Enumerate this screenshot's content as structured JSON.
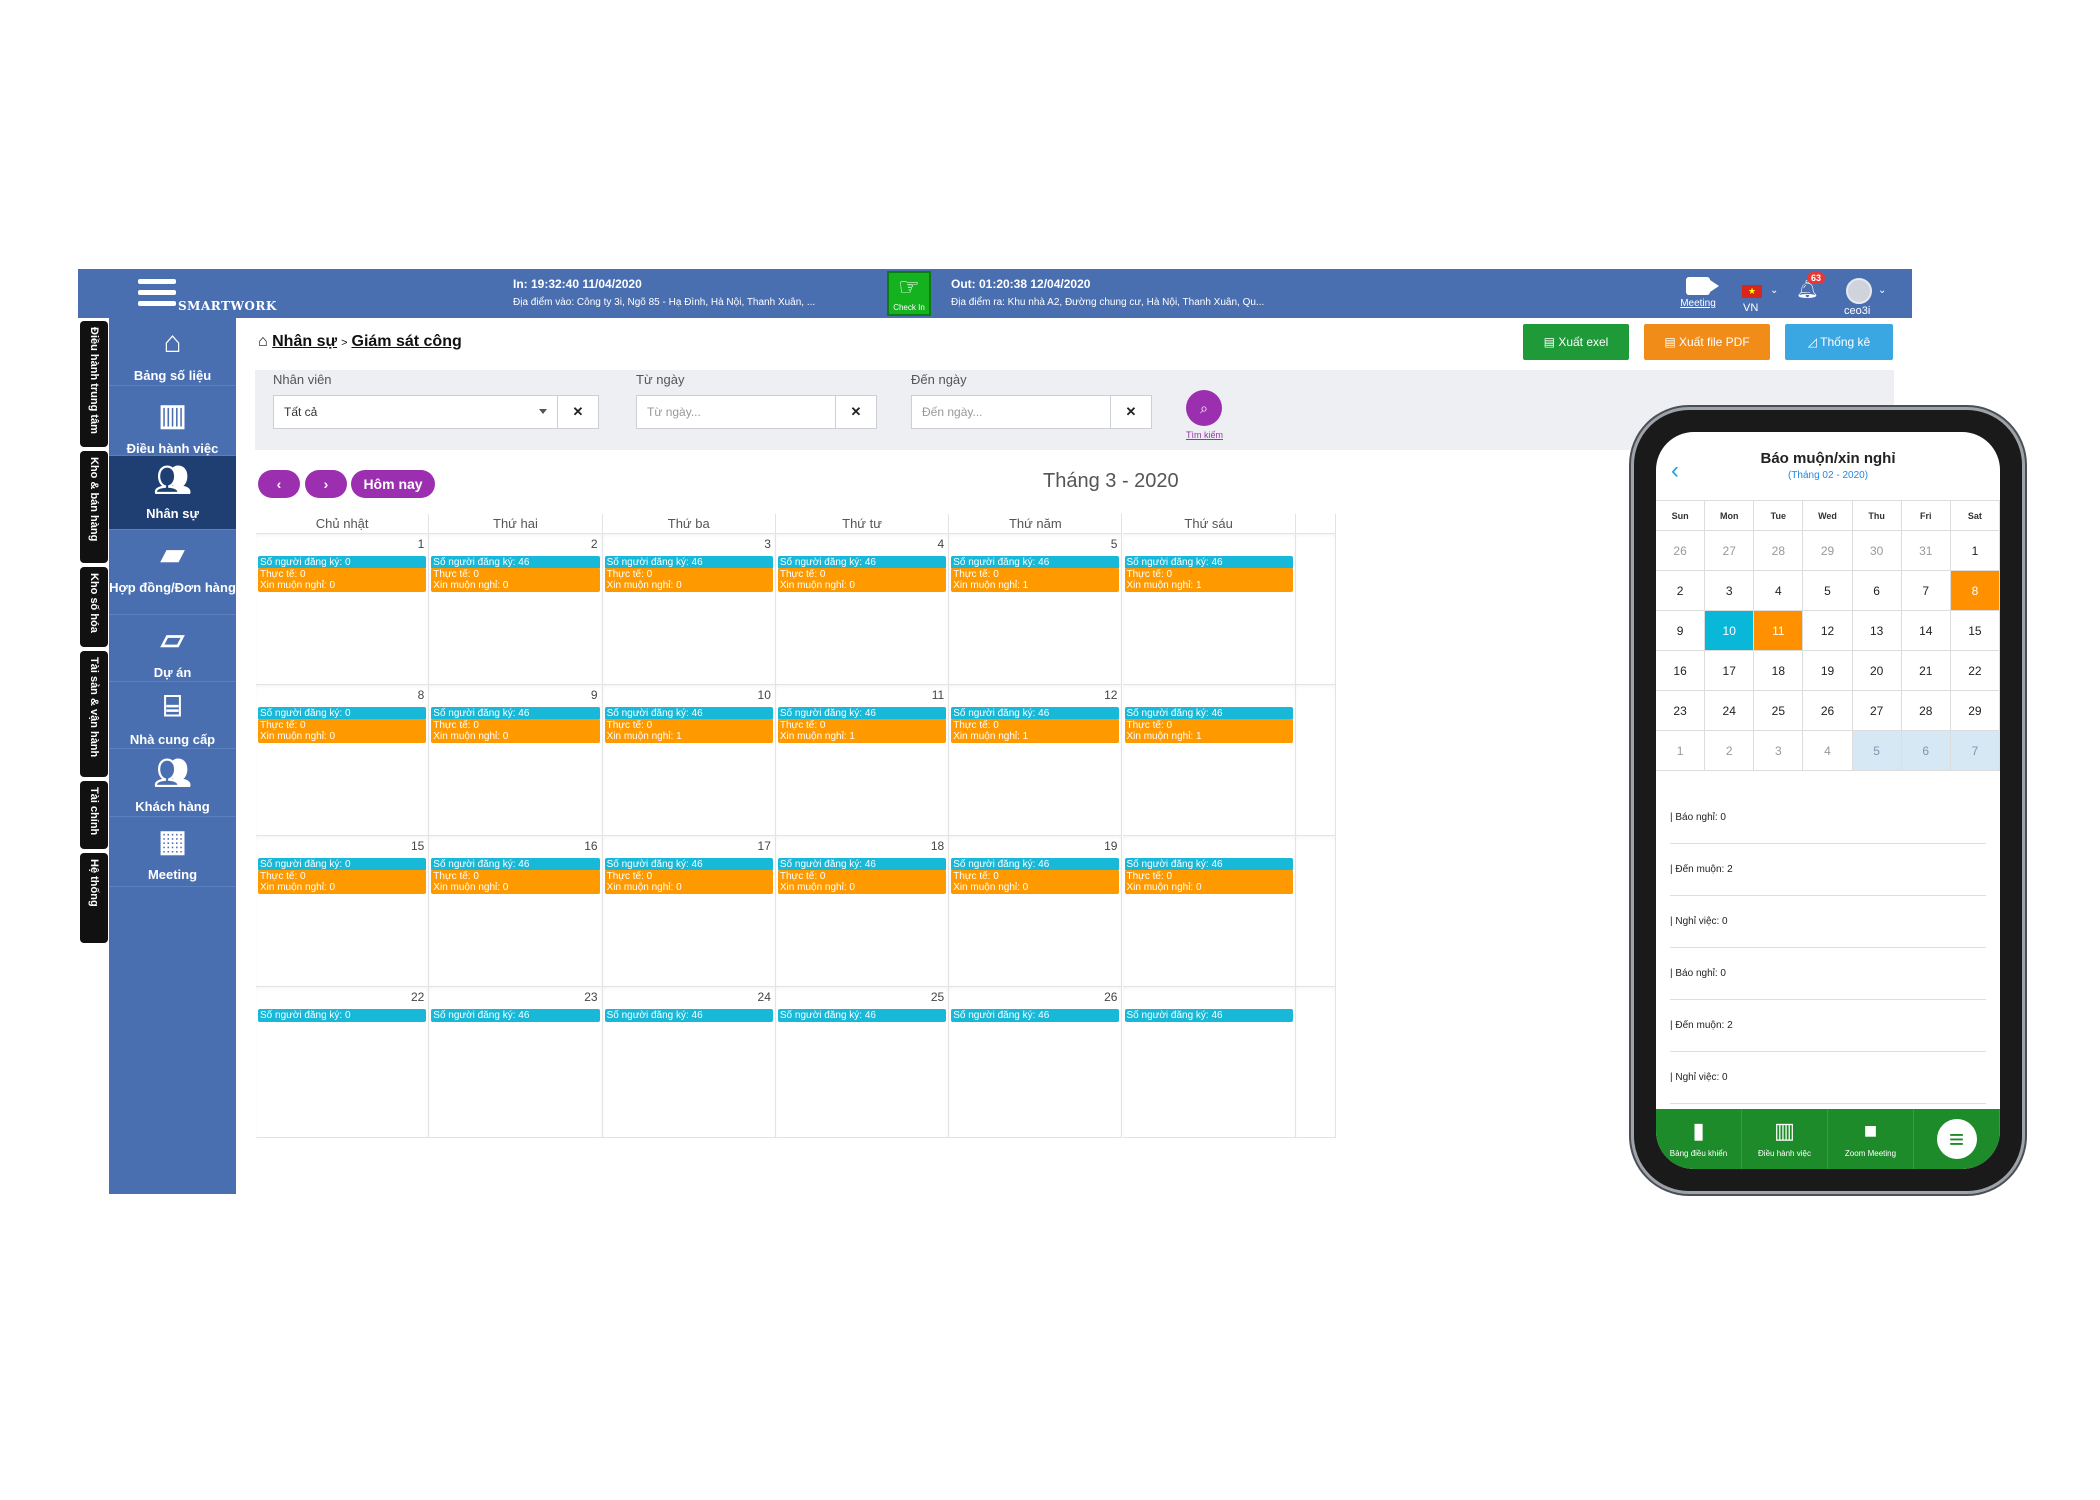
{
  "topbar": {
    "brand": "SMARTWORK",
    "in_time": "In: 19:32:40 11/04/2020",
    "in_place": "Địa điểm vào: Công ty 3i, Ngõ 85 - Hạ Đình, Hà Nội, Thanh Xuân, ...",
    "checkin_label": "Check In",
    "out_time": "Out: 01:20:38 12/04/2020",
    "out_place": "Địa điểm ra: Khu nhà A2, Đường chung cư, Hà Nội, Thanh Xuân, Qu...",
    "meeting_label": "Meeting",
    "language": "VN",
    "notification_count": "63",
    "username": "ceo3i"
  },
  "vertical_tabs": [
    "Điều hành trung tâm",
    "Kho & bán hàng",
    "Kho số hóa",
    "Tài sản & vận hành",
    "Tài chính",
    "Hệ thống"
  ],
  "sidebar": {
    "items": [
      {
        "label": "Bảng số liệu",
        "icon": "home-icon"
      },
      {
        "label": "Điều hành việc",
        "icon": "board-icon"
      },
      {
        "label": "Nhân sự",
        "icon": "users-icon",
        "active": true
      },
      {
        "label": "Hợp đồng/Đơn hàng",
        "icon": "briefcase-icon"
      },
      {
        "label": "Dự án",
        "icon": "folder-open-icon"
      },
      {
        "label": "Nhà cung cấp",
        "icon": "bank-icon"
      },
      {
        "label": "Khách hàng",
        "icon": "users-icon"
      },
      {
        "label": "Meeting",
        "icon": "chat-icon"
      }
    ]
  },
  "breadcrumb": {
    "root": "Nhân sự",
    "current": "Giám sát công"
  },
  "actions": {
    "excel": "Xuất exel",
    "pdf": "Xuất file PDF",
    "stats": "Thống kê"
  },
  "filters": {
    "employee_label": "Nhân viên",
    "employee_value": "Tất cả",
    "from_label": "Từ ngày",
    "from_placeholder": "Từ ngày...",
    "to_label": "Đến ngày",
    "to_placeholder": "Đến ngày...",
    "search_label": "Tìm kiếm"
  },
  "calendar_nav": {
    "prev": "‹",
    "next": "›",
    "today": "Hôm nay",
    "month_title": "Tháng 3 - 2020"
  },
  "calendar": {
    "weekdays": [
      "Chủ nhật",
      "Thứ hai",
      "Thứ ba",
      "Thứ tư",
      "Thứ năm",
      "Thứ sáu"
    ],
    "weeks": [
      [
        {
          "day": "1",
          "events": [
            "Số người đăng ký: 0",
            "Thực tế: 0",
            "Xin muộn nghỉ: 0"
          ]
        },
        {
          "day": "2",
          "events": [
            "Số người đăng ký: 46",
            "Thực tế: 0",
            "Xin muộn nghỉ: 0"
          ]
        },
        {
          "day": "3",
          "events": [
            "Số người đăng ký: 46",
            "Thực tế: 0",
            "Xin muộn nghỉ: 0"
          ]
        },
        {
          "day": "4",
          "events": [
            "Số người đăng ký: 46",
            "Thực tế: 0",
            "Xin muộn nghỉ: 0"
          ]
        },
        {
          "day": "5",
          "events": [
            "Số người đăng ký: 46",
            "Thực tế: 0",
            "Xin muộn nghỉ: 1"
          ]
        },
        {
          "day": "",
          "events": [
            "Số người đăng ký: 46",
            "Thực tế: 0",
            "Xin muộn nghỉ: 1"
          ]
        }
      ],
      [
        {
          "day": "8",
          "events": [
            "Số người đăng ký: 0",
            "Thực tế: 0",
            "Xin muộn nghỉ: 0"
          ]
        },
        {
          "day": "9",
          "events": [
            "Số người đăng ký: 46",
            "Thực tế: 0",
            "Xin muộn nghỉ: 0"
          ]
        },
        {
          "day": "10",
          "events": [
            "Số người đăng ký: 46",
            "Thực tế: 0",
            "Xin muộn nghỉ: 1"
          ]
        },
        {
          "day": "11",
          "events": [
            "Số người đăng ký: 46",
            "Thực tế: 0",
            "Xin muộn nghỉ: 1"
          ]
        },
        {
          "day": "12",
          "events": [
            "Số người đăng ký: 46",
            "Thực tế: 0",
            "Xin muộn nghỉ: 1"
          ]
        },
        {
          "day": "",
          "events": [
            "Số người đăng ký: 46",
            "Thực tế: 0",
            "Xin muộn nghỉ: 1"
          ]
        }
      ],
      [
        {
          "day": "15",
          "events": [
            "Số người đăng ký: 0",
            "Thực tế: 0",
            "Xin muộn nghỉ: 0"
          ]
        },
        {
          "day": "16",
          "events": [
            "Số người đăng ký: 46",
            "Thực tế: 0",
            "Xin muộn nghỉ: 0"
          ]
        },
        {
          "day": "17",
          "events": [
            "Số người đăng ký: 46",
            "Thực tế: 0",
            "Xin muộn nghỉ: 0"
          ]
        },
        {
          "day": "18",
          "events": [
            "Số người đăng ký: 46",
            "Thực tế: 0",
            "Xin muộn nghỉ: 0"
          ]
        },
        {
          "day": "19",
          "events": [
            "Số người đăng ký: 46",
            "Thực tế: 0",
            "Xin muộn nghỉ: 0"
          ]
        },
        {
          "day": "",
          "events": [
            "Số người đăng ký: 46",
            "Thực tế: 0",
            "Xin muộn nghỉ: 0"
          ]
        }
      ],
      [
        {
          "day": "22",
          "events": [
            "Số người đăng ký: 0"
          ]
        },
        {
          "day": "23",
          "events": [
            "Số người đăng ký: 46"
          ]
        },
        {
          "day": "24",
          "events": [
            "Số người đăng ký: 46"
          ]
        },
        {
          "day": "25",
          "events": [
            "Số người đăng ký: 46"
          ]
        },
        {
          "day": "26",
          "events": [
            "Số người đăng ký: 46"
          ]
        },
        {
          "day": "",
          "events": [
            "Số người đăng ký: 46"
          ]
        }
      ]
    ]
  },
  "phone": {
    "title": "Báo muộn/xin nghỉ",
    "subtitle": "(Tháng 02 - 2020)",
    "weekdays": [
      "Sun",
      "Mon",
      "Tue",
      "Wed",
      "Thu",
      "Fri",
      "Sat"
    ],
    "weeks": [
      [
        {
          "d": "26",
          "s": "g"
        },
        {
          "d": "27",
          "s": "g"
        },
        {
          "d": "28",
          "s": "g"
        },
        {
          "d": "29",
          "s": "g"
        },
        {
          "d": "30",
          "s": "g"
        },
        {
          "d": "31",
          "s": "g"
        },
        {
          "d": "1",
          "s": ""
        }
      ],
      [
        {
          "d": "2",
          "s": ""
        },
        {
          "d": "3",
          "s": ""
        },
        {
          "d": "4",
          "s": ""
        },
        {
          "d": "5",
          "s": ""
        },
        {
          "d": "6",
          "s": ""
        },
        {
          "d": "7",
          "s": ""
        },
        {
          "d": "8",
          "s": "or"
        }
      ],
      [
        {
          "d": "9",
          "s": ""
        },
        {
          "d": "10",
          "s": "b"
        },
        {
          "d": "11",
          "s": "or"
        },
        {
          "d": "12",
          "s": ""
        },
        {
          "d": "13",
          "s": ""
        },
        {
          "d": "14",
          "s": ""
        },
        {
          "d": "15",
          "s": ""
        }
      ],
      [
        {
          "d": "16",
          "s": ""
        },
        {
          "d": "17",
          "s": ""
        },
        {
          "d": "18",
          "s": ""
        },
        {
          "d": "19",
          "s": ""
        },
        {
          "d": "20",
          "s": ""
        },
        {
          "d": "21",
          "s": ""
        },
        {
          "d": "22",
          "s": ""
        }
      ],
      [
        {
          "d": "23",
          "s": ""
        },
        {
          "d": "24",
          "s": ""
        },
        {
          "d": "25",
          "s": ""
        },
        {
          "d": "26",
          "s": ""
        },
        {
          "d": "27",
          "s": ""
        },
        {
          "d": "28",
          "s": ""
        },
        {
          "d": "29",
          "s": ""
        }
      ],
      [
        {
          "d": "1",
          "s": "g"
        },
        {
          "d": "2",
          "s": "g"
        },
        {
          "d": "3",
          "s": "g"
        },
        {
          "d": "4",
          "s": "g"
        },
        {
          "d": "5",
          "s": "lb"
        },
        {
          "d": "6",
          "s": "lb"
        },
        {
          "d": "7",
          "s": "lb"
        }
      ]
    ],
    "list": [
      "| Báo nghỉ: 0",
      "| Đến muộn: 2",
      "| Nghỉ việc: 0",
      "| Báo nghỉ: 0",
      "| Đến muộn: 2",
      "| Nghỉ việc: 0"
    ],
    "footer": [
      {
        "label": "Bảng điều khiển",
        "icon": "book-icon"
      },
      {
        "label": "Điều hành việc",
        "icon": "board-icon"
      },
      {
        "label": "Zoom Meeting",
        "icon": "video-icon"
      },
      {
        "label": "",
        "icon": "menu-icon"
      }
    ]
  },
  "colors": {
    "topbar": "#4a6fb1",
    "sidebar_active": "#1f3f73",
    "event_cyan": "#18b8d8",
    "event_orange": "#ff9900",
    "purple": "#9c2fb0",
    "green": "#1e8b2a"
  }
}
